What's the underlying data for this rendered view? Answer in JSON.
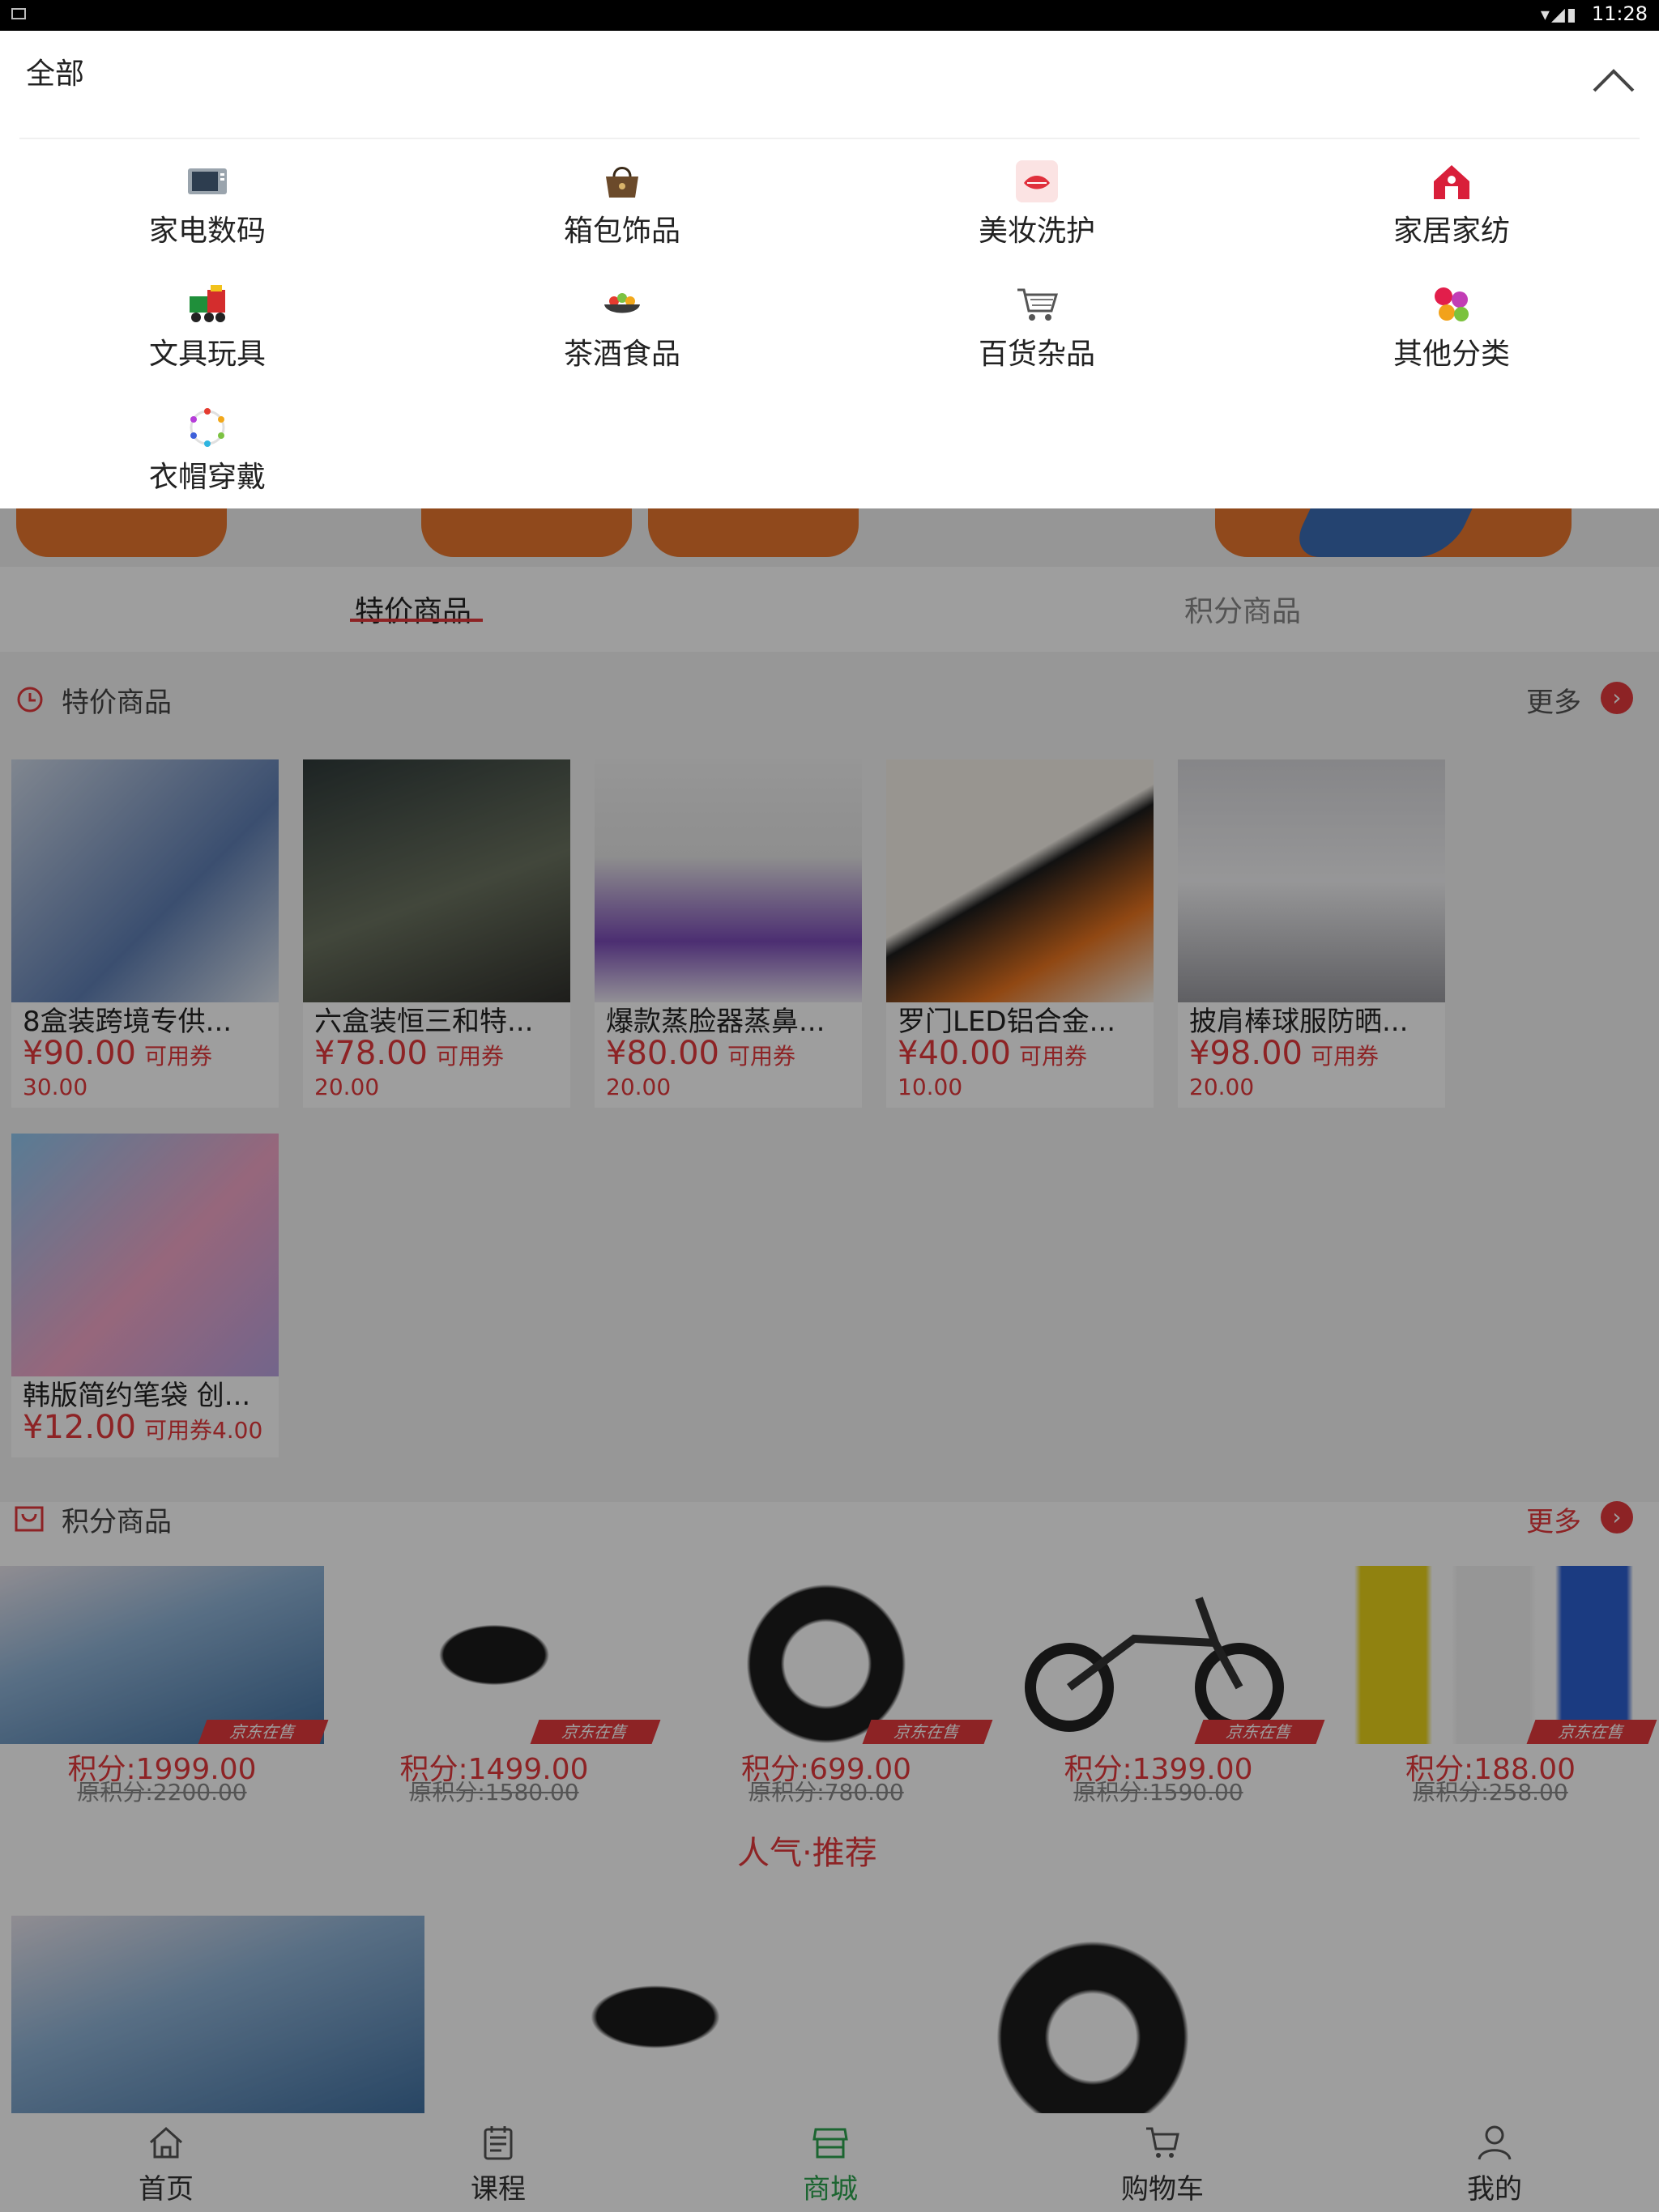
{
  "status_bar": {
    "time": "11:28"
  },
  "category_panel": {
    "all_label": "全部",
    "items": [
      {
        "label": "家电数码",
        "icon": "tv-icon"
      },
      {
        "label": "箱包饰品",
        "icon": "handbag-icon"
      },
      {
        "label": "美妆洗护",
        "icon": "lipstick-icon"
      },
      {
        "label": "家居家纺",
        "icon": "house-icon"
      },
      {
        "label": "文具玩具",
        "icon": "toy-train-icon"
      },
      {
        "label": "茶酒食品",
        "icon": "food-bowl-icon"
      },
      {
        "label": "百货杂品",
        "icon": "shopping-cart-icon"
      },
      {
        "label": "其他分类",
        "icon": "colored-balls-icon"
      },
      {
        "label": "衣帽穿戴",
        "icon": "color-wheel-icon"
      }
    ]
  },
  "tabs": [
    {
      "label": "特价商品",
      "active": true
    },
    {
      "label": "积分商品",
      "active": false
    }
  ],
  "special": {
    "title": "特价商品",
    "more": "更多",
    "tag": "可用券",
    "items": [
      {
        "name": "8盒装跨境专供...",
        "price": "¥90.00",
        "coupon": "30.00"
      },
      {
        "name": "六盒装恒三和特...",
        "price": "¥78.00",
        "coupon": "20.00"
      },
      {
        "name": "爆款蒸脸器蒸鼻...",
        "price": "¥80.00",
        "coupon": "20.00"
      },
      {
        "name": "罗门LED铝合金...",
        "price": "¥40.00",
        "coupon": "10.00"
      },
      {
        "name": "披肩棒球服防晒...",
        "price": "¥98.00",
        "coupon": "20.00"
      },
      {
        "name": "韩版简约笔袋 创...",
        "price": "¥12.00",
        "tag_full": "可用券4.00"
      }
    ]
  },
  "points": {
    "title": "积分商品",
    "more": "更多",
    "ribbon": "京东在售",
    "items": [
      {
        "points": "积分:1999.00",
        "original": "原积分:2200.00"
      },
      {
        "points": "积分:1499.00",
        "original": "原积分:1580.00"
      },
      {
        "points": "积分:699.00",
        "original": "原积分:780.00"
      },
      {
        "points": "积分:1399.00",
        "original": "原积分:1590.00"
      },
      {
        "points": "积分:188.00",
        "original": "原积分:258.00"
      }
    ]
  },
  "recommend": {
    "title": "人气·推荐"
  },
  "tabbar": [
    {
      "label": "首页",
      "icon": "home-icon"
    },
    {
      "label": "课程",
      "icon": "notepad-icon"
    },
    {
      "label": "商城",
      "icon": "store-icon",
      "active": true
    },
    {
      "label": "购物车",
      "icon": "cart-icon"
    },
    {
      "label": "我的",
      "icon": "user-icon"
    }
  ],
  "colors": {
    "accent": "#e4393c",
    "active_tab": "#2ea44f"
  }
}
